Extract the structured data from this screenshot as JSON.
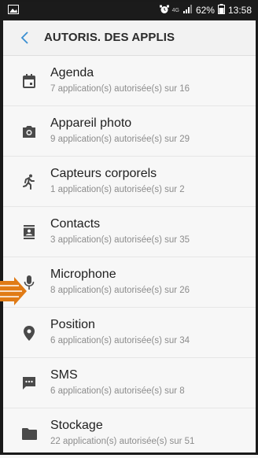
{
  "status_bar": {
    "network_label": "4G",
    "battery_percent": "62%",
    "time": "13:58"
  },
  "header": {
    "title": "AUTORIS. DES APPLIS",
    "back_icon": "chevron-left-icon"
  },
  "items": [
    {
      "label": "Agenda",
      "sub": "7 application(s) autorisée(s) sur 16",
      "icon": "calendar-icon"
    },
    {
      "label": "Appareil photo",
      "sub": "9 application(s) autorisée(s) sur 29",
      "icon": "camera-icon"
    },
    {
      "label": "Capteurs corporels",
      "sub": "1 application(s) autorisée(s) sur 2",
      "icon": "running-person-icon"
    },
    {
      "label": "Contacts",
      "sub": "3 application(s) autorisée(s) sur 35",
      "icon": "contacts-icon"
    },
    {
      "label": "Microphone",
      "sub": "8 application(s) autorisée(s) sur 26",
      "icon": "microphone-icon"
    },
    {
      "label": "Position",
      "sub": "6 application(s) autorisée(s) sur 34",
      "icon": "location-pin-icon"
    },
    {
      "label": "SMS",
      "sub": "6 application(s) autorisée(s) sur 8",
      "icon": "message-icon"
    },
    {
      "label": "Stockage",
      "sub": "22 application(s) autorisée(s) sur 51",
      "icon": "folder-icon"
    }
  ],
  "colors": {
    "icon": "#4a4a4a",
    "accent": "#3a8fd1",
    "annotation_arrow": "#e07b16"
  }
}
